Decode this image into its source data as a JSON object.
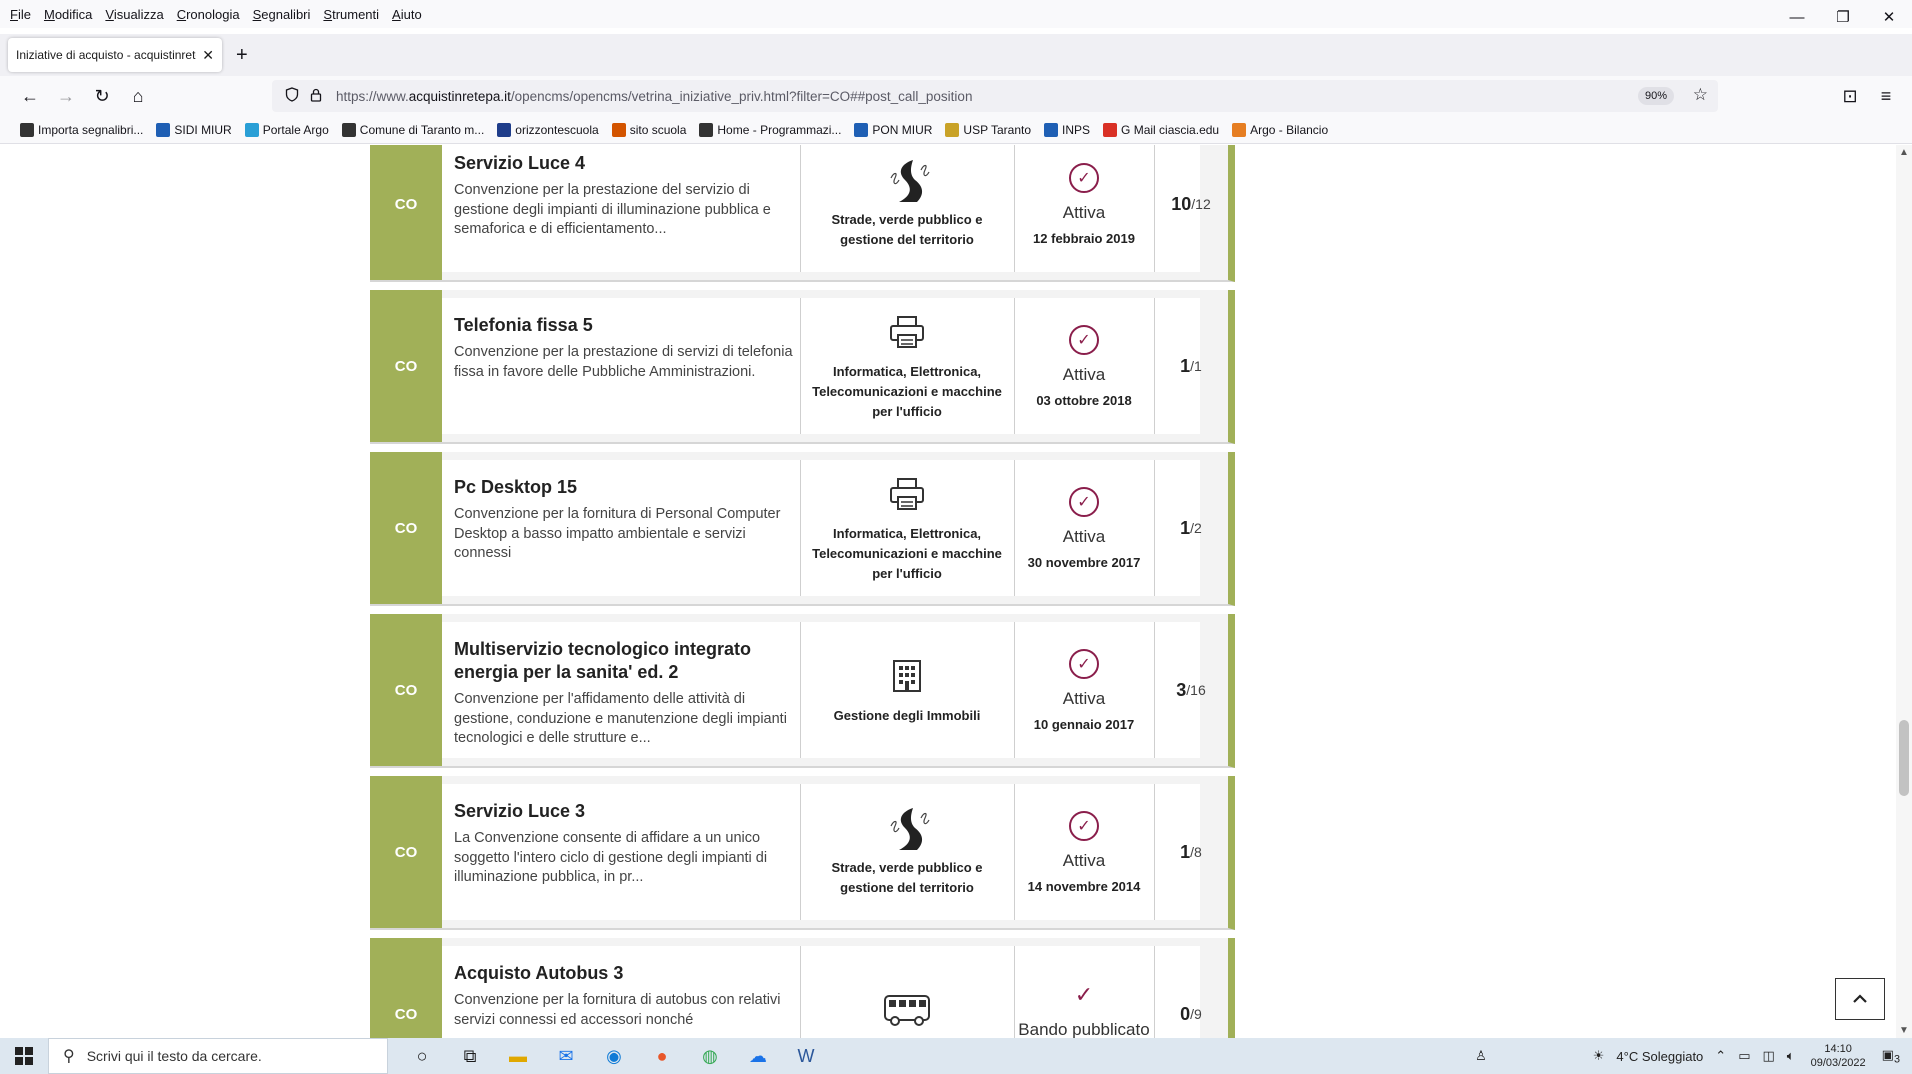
{
  "menubar": {
    "items": [
      "File",
      "Modifica",
      "Visualizza",
      "Cronologia",
      "Segnalibri",
      "Strumenti",
      "Aiuto"
    ]
  },
  "window_controls": {
    "minimize": "—",
    "restore": "❐",
    "close": "✕"
  },
  "tab": {
    "title": "Iniziative di acquisto - acquistinrete",
    "close": "✕",
    "new_tab": "+"
  },
  "navbar": {
    "back": "←",
    "forward": "→",
    "reload": "↻",
    "home": "⌂",
    "url_prefix": "https://www.",
    "url_host": "acquistinretepa.it",
    "url_path": "/opencms/opencms/vetrina_iniziative_priv.html?filter=CO##post_call_position",
    "zoom": "90%",
    "bookmark_star": "☆",
    "pocket": "⊡",
    "menu": "≡"
  },
  "bookmarks": [
    {
      "label": "Importa segnalibri...",
      "icon": "import-icon",
      "color": "#333333"
    },
    {
      "label": "SIDI MIUR",
      "icon": "sidi-icon",
      "color": "#1f5fb4"
    },
    {
      "label": "Portale Argo",
      "icon": "argo-icon",
      "color": "#2a9fd6"
    },
    {
      "label": "Comune di Taranto m...",
      "icon": "globe-icon",
      "color": "#333333"
    },
    {
      "label": "orizzontescuola",
      "icon": "orizzonte-icon",
      "color": "#1f3d8a"
    },
    {
      "label": "sito scuola",
      "icon": "school-icon",
      "color": "#d35400"
    },
    {
      "label": "Home - Programmazi...",
      "icon": "globe-icon",
      "color": "#333333"
    },
    {
      "label": "PON MIUR",
      "icon": "pon-icon",
      "color": "#1f5fb4"
    },
    {
      "label": "USP Taranto",
      "icon": "usp-icon",
      "color": "#c9a227"
    },
    {
      "label": "INPS",
      "icon": "inps-icon",
      "color": "#1f5fb4"
    },
    {
      "label": "G Mail ciascia.edu",
      "icon": "gmail-icon",
      "color": "#d93025"
    },
    {
      "label": "Argo - Bilancio",
      "icon": "argo-bilancio-icon",
      "color": "#e67e22"
    }
  ],
  "cards": [
    {
      "badge": "CO",
      "title": "Servizio Luce 4",
      "desc": "Convenzione per la prestazione del servizio di gestione degli impianti di illuminazione pubblica e semaforica e di efficientamento...",
      "category": "Strade, verde pubblico e gestione del territorio",
      "category_icon": "road-icon",
      "status": "Attiva",
      "status_icon": "check-circle-icon",
      "date": "12 febbraio 2019",
      "count": "10",
      "total": "/12"
    },
    {
      "badge": "CO",
      "title": "Telefonia fissa 5",
      "desc": "Convenzione per la prestazione di servizi di telefonia fissa in favore delle Pubbliche Amministrazioni.",
      "category": "Informatica, Elettronica, Telecomunicazioni e macchine per l'ufficio",
      "category_icon": "printer-icon",
      "status": "Attiva",
      "status_icon": "check-circle-icon",
      "date": "03 ottobre 2018",
      "count": "1",
      "total": "/1"
    },
    {
      "badge": "CO",
      "title": "Pc Desktop 15",
      "desc": "Convenzione per la fornitura di Personal Computer Desktop a basso impatto ambientale e servizi connessi",
      "category": "Informatica, Elettronica, Telecomunicazioni e macchine per l'ufficio",
      "category_icon": "printer-icon",
      "status": "Attiva",
      "status_icon": "check-circle-icon",
      "date": "30 novembre 2017",
      "count": "1",
      "total": "/2"
    },
    {
      "badge": "CO",
      "title": "Multiservizio tecnologico integrato energia per la sanita' ed. 2",
      "desc": "Convenzione per l'affidamento delle attività di gestione, conduzione e manutenzione degli impianti tecnologici e delle strutture e...",
      "category": "Gestione degli Immobili",
      "category_icon": "building-icon",
      "status": "Attiva",
      "status_icon": "check-circle-icon",
      "date": "10 gennaio 2017",
      "count": "3",
      "total": "/16"
    },
    {
      "badge": "CO",
      "title": "Servizio Luce 3",
      "desc": "La Convenzione consente di affidare a un unico soggetto l'intero ciclo di gestione degli impianti di illuminazione pubblica, in pr...",
      "category": "Strade, verde pubblico e gestione del territorio",
      "category_icon": "road-icon",
      "status": "Attiva",
      "status_icon": "check-circle-icon",
      "date": "14 novembre 2014",
      "count": "1",
      "total": "/8"
    },
    {
      "badge": "CO",
      "title": "Acquisto Autobus 3",
      "desc": "Convenzione per la fornitura di autobus con relativi servizi connessi ed accessori nonché",
      "category": "",
      "category_icon": "bus-icon",
      "status": "Bando pubblicato",
      "status_icon": "check-icon",
      "date": "",
      "count": "0",
      "total": "/9"
    }
  ],
  "back_to_top": "⌃",
  "taskbar": {
    "search_placeholder": "Scrivi qui il testo da cercare.",
    "weather": "4°C Soleggiato",
    "time": "14:10",
    "date": "09/03/2022",
    "notifications": "3"
  }
}
